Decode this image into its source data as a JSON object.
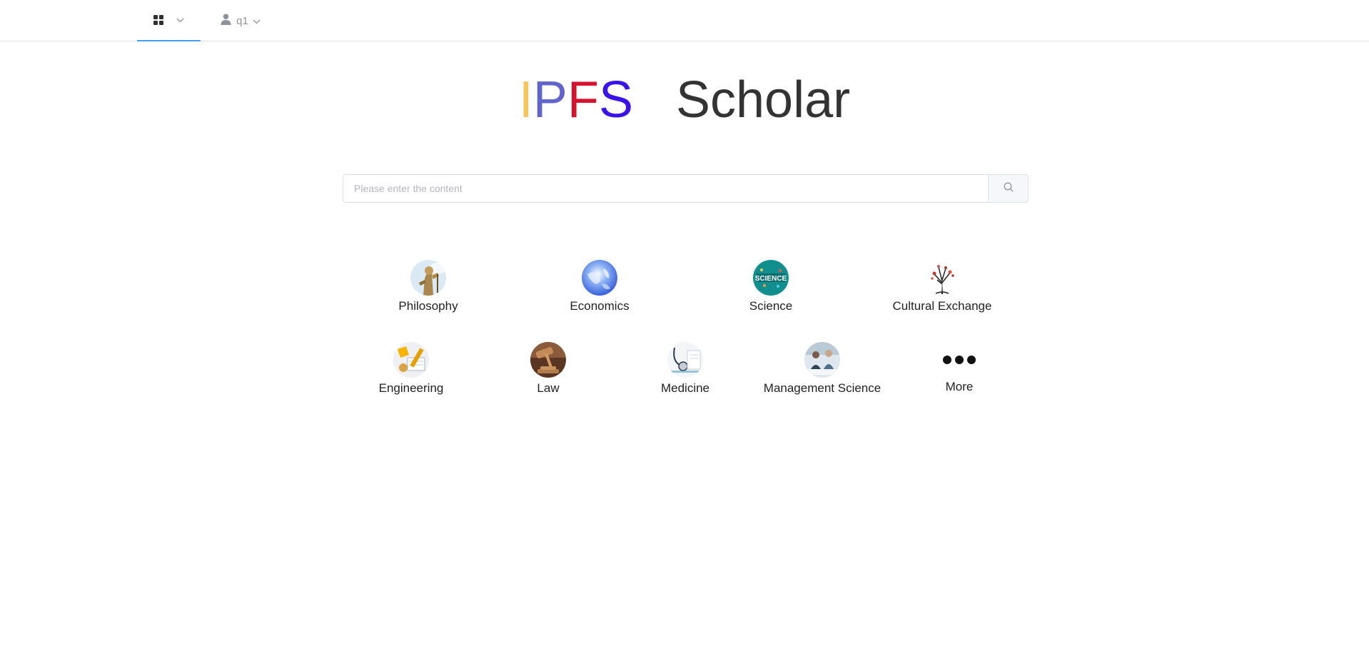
{
  "nav": {
    "apps_icon": "grid-icon",
    "user_icon": "person-icon",
    "username": "q1"
  },
  "logo": {
    "i": "I",
    "p": "P",
    "f": "F",
    "s": "S",
    "scholar": "Scholar"
  },
  "search": {
    "placeholder": "Please enter the content",
    "button_icon": "search-icon"
  },
  "categories": [
    {
      "label": "Philosophy",
      "icon": "philosophy-statue-image"
    },
    {
      "label": "Economics",
      "icon": "economics-globe-image"
    },
    {
      "label": "Science",
      "icon": "science-badge-image"
    },
    {
      "label": "Cultural Exchange",
      "icon": "cultural-tree-image"
    },
    {
      "label": "Engineering",
      "icon": "engineering-image"
    },
    {
      "label": "Law",
      "icon": "law-gavel-image"
    },
    {
      "label": "Medicine",
      "icon": "medicine-stethoscope-image"
    },
    {
      "label": "Management Science",
      "icon": "management-meeting-image"
    },
    {
      "label": "More",
      "icon": "more-dots-icon"
    }
  ],
  "colors": {
    "accent": "#409eff",
    "logo_i": "#f7c45d",
    "logo_p": "#6064cc",
    "logo_f": "#d8122e",
    "logo_s": "#3a12f0",
    "logo_scholar": "#333333"
  }
}
